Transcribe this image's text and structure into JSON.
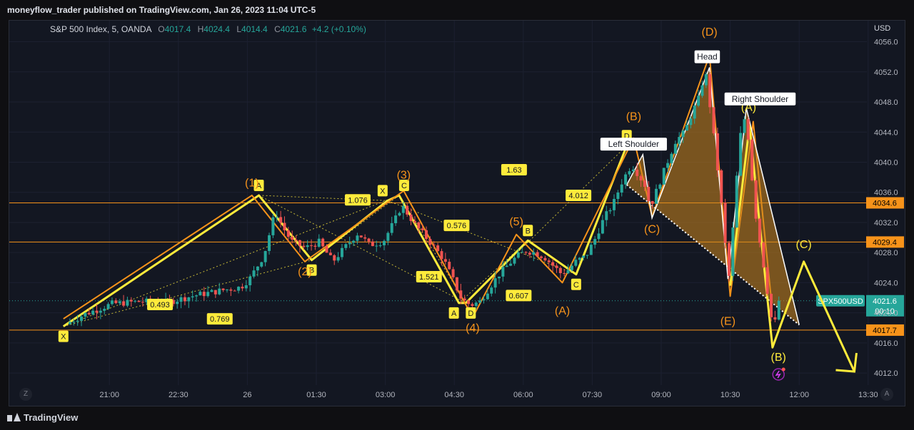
{
  "header": {
    "published_text": "moneyflow_trader published on TradingView.com, Jan 26, 2023 11:04 UTC-5"
  },
  "footer": {
    "brand": "TradingView"
  },
  "nav": {
    "left_btn": "Z",
    "right_btn": "A"
  },
  "legend": {
    "symbol": "S&P 500 Index, 5, OANDA",
    "o_label": "O",
    "o_value": "4017.4",
    "h_label": "H",
    "h_value": "4024.4",
    "l_label": "L",
    "l_value": "4014.4",
    "c_label": "C",
    "c_value": "4021.6",
    "change": "+4.2 (+0.10%)"
  },
  "chart_data": {
    "type": "candlestick",
    "currency": "USD",
    "grid": true,
    "ylim": [
      4010.4,
      4058.8
    ],
    "y_ticks": [
      4012.0,
      4016.0,
      4020.0,
      4024.0,
      4028.0,
      4032.0,
      4036.0,
      4040.0,
      4044.0,
      4048.0,
      4052.0,
      4056.0
    ],
    "x_ticks": [
      {
        "label": "21:00",
        "t": 0.5
      },
      {
        "label": "22:30",
        "t": 2.0
      },
      {
        "label": "26",
        "t": 3.5
      },
      {
        "label": "01:30",
        "t": 5.0
      },
      {
        "label": "03:00",
        "t": 6.5
      },
      {
        "label": "04:30",
        "t": 8.0
      },
      {
        "label": "06:00",
        "t": 9.5
      },
      {
        "label": "07:30",
        "t": 11.0
      },
      {
        "label": "09:00",
        "t": 12.5
      },
      {
        "label": "10:30",
        "t": 14.0
      },
      {
        "label": "12:00",
        "t": 15.5
      },
      {
        "label": "13:30",
        "t": 17.0
      }
    ],
    "price_path": [
      [
        -0.4,
        4018.5
      ],
      [
        0.0,
        4019.8
      ],
      [
        0.6,
        4021.2
      ],
      [
        1.2,
        4021.5
      ],
      [
        1.8,
        4021.4
      ],
      [
        2.4,
        4022.3
      ],
      [
        3.0,
        4023.0
      ],
      [
        3.4,
        4023.4
      ],
      [
        3.6,
        4024.6
      ],
      [
        3.9,
        4027.6
      ],
      [
        4.15,
        4033.5
      ],
      [
        4.3,
        4031.5
      ],
      [
        4.5,
        4029.5
      ],
      [
        4.8,
        4028.6
      ],
      [
        5.1,
        4029.4
      ],
      [
        5.4,
        4026.8
      ],
      [
        5.65,
        4028.6
      ],
      [
        5.95,
        4030.6
      ],
      [
        6.2,
        4029.0
      ],
      [
        6.5,
        4029.5
      ],
      [
        6.75,
        4032.3
      ],
      [
        6.9,
        4034.3
      ],
      [
        7.2,
        4031.6
      ],
      [
        7.5,
        4029.5
      ],
      [
        7.8,
        4027.2
      ],
      [
        8.0,
        4024.6
      ],
      [
        8.2,
        4021.8
      ],
      [
        8.4,
        4021.0
      ],
      [
        8.6,
        4021.5
      ],
      [
        8.8,
        4023.3
      ],
      [
        9.0,
        4025.0
      ],
      [
        9.2,
        4026.3
      ],
      [
        9.4,
        4027.5
      ],
      [
        9.6,
        4028.2
      ],
      [
        9.8,
        4028.0
      ],
      [
        10.0,
        4027.4
      ],
      [
        10.2,
        4026.2
      ],
      [
        10.35,
        4025.3
      ],
      [
        10.5,
        4025.6
      ],
      [
        10.7,
        4026.9
      ],
      [
        10.9,
        4027.5
      ],
      [
        11.1,
        4029.8
      ],
      [
        11.3,
        4032.6
      ],
      [
        11.5,
        4034.5
      ],
      [
        11.7,
        4037.6
      ],
      [
        11.9,
        4039.7
      ],
      [
        12.05,
        4038.3
      ],
      [
        12.2,
        4036.8
      ],
      [
        12.3,
        4034.0
      ],
      [
        12.45,
        4036.4
      ],
      [
        12.65,
        4039.6
      ],
      [
        12.85,
        4042.8
      ],
      [
        13.05,
        4044.0
      ],
      [
        13.2,
        4046.4
      ],
      [
        13.35,
        4048.4
      ],
      [
        13.5,
        4052.2
      ],
      [
        13.62,
        4046.6
      ],
      [
        13.72,
        4041.6
      ],
      [
        13.82,
        4036.2
      ],
      [
        13.92,
        4030.2
      ],
      [
        14.0,
        4023.6
      ],
      [
        14.12,
        4032.6
      ],
      [
        14.22,
        4041.2
      ],
      [
        14.32,
        4046.4
      ],
      [
        14.42,
        4044.2
      ],
      [
        14.52,
        4037.6
      ],
      [
        14.62,
        4031.6
      ],
      [
        14.72,
        4028.2
      ],
      [
        14.82,
        4024.2
      ],
      [
        14.92,
        4019.8
      ],
      [
        15.0,
        4017.4
      ],
      [
        15.05,
        4021.6
      ]
    ],
    "horizontal_levels": [
      {
        "price": 4034.6,
        "label": "4034.6",
        "color": "#f7931a"
      },
      {
        "price": 4029.4,
        "label": "4029.4",
        "color": "#f7931a"
      },
      {
        "price": 4017.7,
        "label": "4017.7",
        "color": "#f7931a"
      }
    ],
    "last_price": {
      "price": 4021.6,
      "symbol": "SPX500USD",
      "value": "4021.6",
      "countdown": "00:10",
      "color": "#26a69a"
    },
    "harmonic_pattern": {
      "color": "#ffeb3b",
      "points": [
        {
          "label": "X",
          "t": -0.5,
          "p": 4018.2,
          "pos": "below"
        },
        {
          "label": "A",
          "t": 3.75,
          "p": 4035.6,
          "pos": "above"
        },
        {
          "label": "B",
          "t": 4.9,
          "p": 4027.0,
          "pos": "below"
        },
        {
          "label": "X",
          "t": 6.55,
          "p": 4034.9,
          "pos": "above-left"
        },
        {
          "label": "C",
          "t": 6.8,
          "p": 4035.6,
          "pos": "above-right"
        },
        {
          "label": "A",
          "t": 8.1,
          "p": 4021.3,
          "pos": "below-left"
        },
        {
          "label": "D",
          "t": 8.25,
          "p": 4021.3,
          "pos": "below-right"
        },
        {
          "label": "B",
          "t": 9.6,
          "p": 4029.6,
          "pos": "above"
        },
        {
          "label": "C",
          "t": 10.65,
          "p": 4025.1,
          "pos": "below"
        },
        {
          "label": "D",
          "t": 11.75,
          "p": 4042.2,
          "pos": "above"
        }
      ],
      "ratios": [
        {
          "label": "0.493",
          "t": 1.6,
          "p": 4021.1
        },
        {
          "label": "0.769",
          "t": 2.9,
          "p": 4019.2
        },
        {
          "label": "1.076",
          "t": 5.9,
          "p": 4035.0
        },
        {
          "label": "1.521",
          "t": 7.45,
          "p": 4024.8
        },
        {
          "label": "0.576",
          "t": 8.05,
          "p": 4031.6
        },
        {
          "label": "0.607",
          "t": 9.4,
          "p": 4022.3
        },
        {
          "label": "1.63",
          "t": 9.3,
          "p": 4039.0
        },
        {
          "label": "4.012",
          "t": 10.7,
          "p": 4035.6
        }
      ]
    },
    "wave_labels": [
      {
        "label": "(1)",
        "t": 3.6,
        "p": 4036.8,
        "color": "#f7931a"
      },
      {
        "label": "(2)",
        "t": 4.75,
        "p": 4025.0,
        "color": "#f7931a"
      },
      {
        "label": "(3)",
        "t": 6.9,
        "p": 4037.8,
        "color": "#f7931a"
      },
      {
        "label": "(4)",
        "t": 8.4,
        "p": 4017.5,
        "color": "#f7931a"
      },
      {
        "label": "(5)",
        "t": 9.35,
        "p": 4031.6,
        "color": "#f7931a"
      },
      {
        "label": "(A)",
        "t": 10.35,
        "p": 4019.8,
        "color": "#f7931a"
      },
      {
        "label": "(B)",
        "t": 11.9,
        "p": 4045.6,
        "color": "#f7931a"
      },
      {
        "label": "(C)",
        "t": 12.3,
        "p": 4030.6,
        "color": "#f7931a"
      },
      {
        "label": "(D)",
        "t": 13.55,
        "p": 4056.8,
        "color": "#f7931a"
      },
      {
        "label": "(E)",
        "t": 13.95,
        "p": 4018.4,
        "color": "#f7931a"
      },
      {
        "label": "(A)",
        "t": 14.4,
        "p": 4046.8,
        "color": "#ffeb3b"
      },
      {
        "label": "(B)",
        "t": 15.05,
        "p": 4013.6,
        "color": "#ffeb3b"
      },
      {
        "label": "(C)",
        "t": 15.6,
        "p": 4028.6,
        "color": "#ffeb3b"
      }
    ],
    "annotations": [
      {
        "text": "Left Shoulder",
        "t": 11.9,
        "p": 4042.4
      },
      {
        "text": "Head",
        "t": 13.5,
        "p": 4054.0
      },
      {
        "text": "Right Shoulder",
        "t": 14.65,
        "p": 4048.4
      }
    ]
  }
}
